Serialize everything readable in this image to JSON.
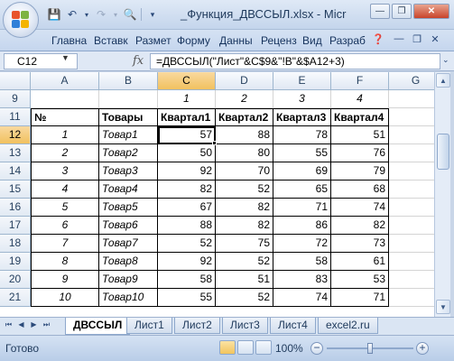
{
  "window": {
    "title": "_Функция_ДВССЫЛ.xlsx - Micr",
    "minimize": "—",
    "restore": "❐",
    "close": "✕"
  },
  "ribbon_tabs": [
    "Главна",
    "Вставк",
    "Размет",
    "Форму",
    "Данны",
    "Реценз",
    "Вид",
    "Разраб"
  ],
  "formula_bar": {
    "name_box": "C12",
    "fx": "fx",
    "formula": "=ДВССЫЛ(\"Лист\"&C$9&\"!B\"&$A12+3)"
  },
  "columns": [
    "A",
    "B",
    "C",
    "D",
    "E",
    "F",
    "G"
  ],
  "selected_column": "C",
  "selected_row": "12",
  "rows": [
    {
      "n": "9",
      "a": "",
      "b": "",
      "c": "1",
      "d": "2",
      "e": "3",
      "f": "4"
    },
    {
      "n": "11",
      "a": "№",
      "b": "Товары",
      "c": "Квартал1",
      "d": "Квартал2",
      "e": "Квартал3",
      "f": "Квартал4"
    },
    {
      "n": "12",
      "a": "1",
      "b": "Товар1",
      "c": "57",
      "d": "88",
      "e": "78",
      "f": "51"
    },
    {
      "n": "13",
      "a": "2",
      "b": "Товар2",
      "c": "50",
      "d": "80",
      "e": "55",
      "f": "76"
    },
    {
      "n": "14",
      "a": "3",
      "b": "Товар3",
      "c": "92",
      "d": "70",
      "e": "69",
      "f": "79"
    },
    {
      "n": "15",
      "a": "4",
      "b": "Товар4",
      "c": "82",
      "d": "52",
      "e": "65",
      "f": "68"
    },
    {
      "n": "16",
      "a": "5",
      "b": "Товар5",
      "c": "67",
      "d": "82",
      "e": "71",
      "f": "74"
    },
    {
      "n": "17",
      "a": "6",
      "b": "Товар6",
      "c": "88",
      "d": "82",
      "e": "86",
      "f": "82"
    },
    {
      "n": "18",
      "a": "7",
      "b": "Товар7",
      "c": "52",
      "d": "75",
      "e": "72",
      "f": "73"
    },
    {
      "n": "19",
      "a": "8",
      "b": "Товар8",
      "c": "92",
      "d": "52",
      "e": "58",
      "f": "61"
    },
    {
      "n": "20",
      "a": "9",
      "b": "Товар9",
      "c": "58",
      "d": "51",
      "e": "83",
      "f": "53"
    },
    {
      "n": "21",
      "a": "10",
      "b": "Товар10",
      "c": "55",
      "d": "52",
      "e": "74",
      "f": "71"
    }
  ],
  "sheet_tabs": [
    "ДВССЫЛ",
    "Лист1",
    "Лист2",
    "Лист3",
    "Лист4",
    "excel2.ru"
  ],
  "active_sheet": "ДВССЫЛ",
  "status": {
    "ready": "Готово",
    "zoom": "100%"
  },
  "colors": {
    "selection_header": "#f1c15f",
    "grid_line": "#d4d4d4"
  }
}
